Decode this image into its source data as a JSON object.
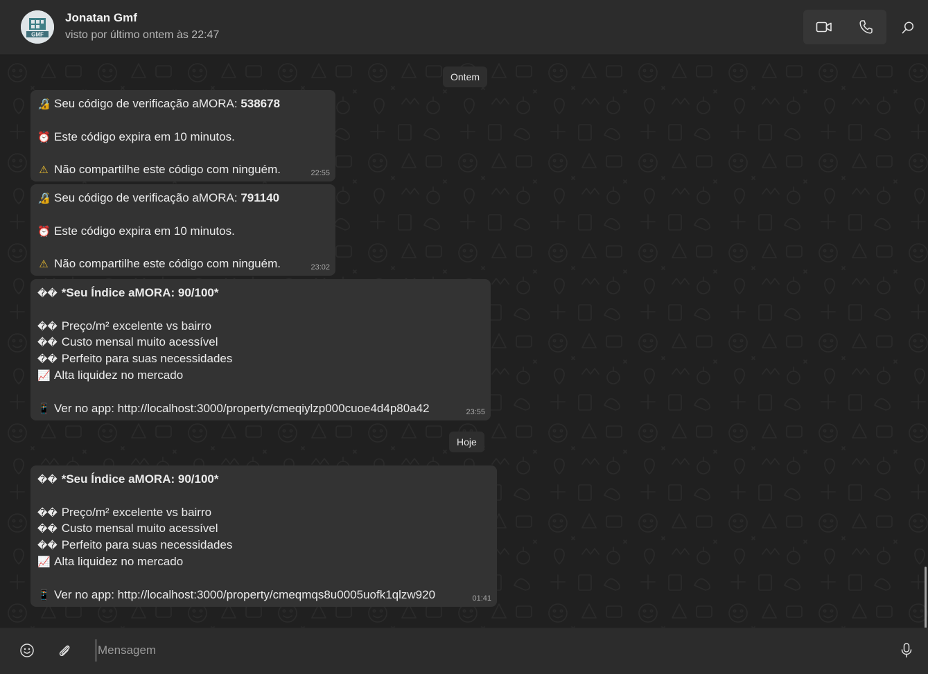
{
  "header": {
    "contact_name": "Jonatan Gmf",
    "last_seen": "visto por último ontem às 22:47",
    "avatar_text": "GMF",
    "icons": [
      "video-camera-icon",
      "phone-icon",
      "search-icon"
    ]
  },
  "chat": {
    "date_yesterday": "Ontem",
    "date_today": "Hoje",
    "messages": [
      {
        "l1_prefix": "Seu código de verificação aMORA: ",
        "l1_code": "538678",
        "l2": "Este código expira em 10 minutos.",
        "l3": "Não compartilhe este código com ninguém.",
        "time": "22:55"
      },
      {
        "l1_prefix": "Seu código de verificação aMORA: ",
        "l1_code": "791140",
        "l2": "Este código expira em 10 minutos.",
        "l3": "Não compartilhe este código com ninguém.",
        "time": "23:02"
      },
      {
        "title": "*Seu Índice aMORA: 90/100*",
        "item1": "Preço/m² excelente vs bairro",
        "item2": "Custo mensal muito acessível",
        "item3": "Perfeito para suas necessidades",
        "item4": "Alta liquidez no mercado",
        "link": "Ver no app: http://localhost:3000/property/cmeqiylzp000cuoe4d4p80a42",
        "time": "23:55"
      },
      {
        "title": "*Seu Índice aMORA: 90/100*",
        "item1": "Preço/m² excelente vs bairro",
        "item2": "Custo mensal muito acessível",
        "item3": "Perfeito para suas necessidades",
        "item4": "Alta liquidez no mercado",
        "link": "Ver no app: http://localhost:3000/property/cmeqmqs8u0005uofk1qlzw920",
        "time": "01:41"
      }
    ],
    "unknown_glyph": "��"
  },
  "composer": {
    "placeholder": "Mensagem",
    "icons": [
      "emoji-icon",
      "attach-icon",
      "microphone-icon"
    ]
  },
  "colors": {
    "header_bg": "#2c2c2c",
    "chat_bg": "#202020",
    "bubble_bg": "#333333",
    "text": "#ebebeb",
    "timestamp": "#a8a8a8"
  }
}
